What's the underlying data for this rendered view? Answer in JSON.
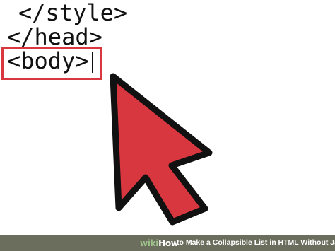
{
  "editor": {
    "lines": [
      "</style>",
      "</head>",
      "<body>"
    ]
  },
  "watermark": {
    "logo_wiki": "wiki",
    "logo_how": "How",
    "title": "to Make a Collapsible List in HTML Without Javascript"
  },
  "colors": {
    "highlight": "#d9373f",
    "cursor_fill": "#d9373f",
    "cursor_stroke": "#111111",
    "bar": "#6b6d5d"
  },
  "icons": {
    "cursor": "mouse-pointer-arrow-icon"
  }
}
